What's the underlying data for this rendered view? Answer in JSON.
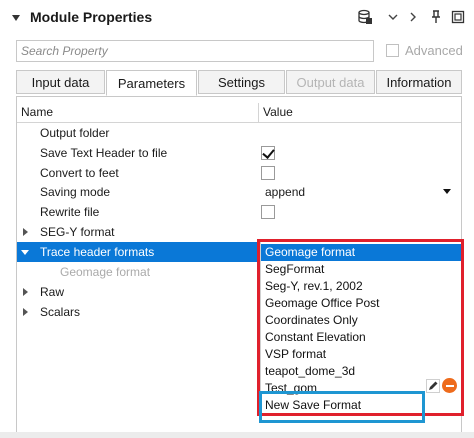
{
  "window": {
    "title": "Module Properties"
  },
  "search": {
    "placeholder": "Search Property"
  },
  "advanced": {
    "label": "Advanced",
    "checked": false
  },
  "tabs": [
    {
      "label": "Input data",
      "state": "normal"
    },
    {
      "label": "Parameters",
      "state": "active"
    },
    {
      "label": "Settings",
      "state": "normal"
    },
    {
      "label": "Output data",
      "state": "disabled"
    },
    {
      "label": "Information",
      "state": "normal"
    }
  ],
  "grid": {
    "headers": {
      "name": "Name",
      "value": "Value"
    },
    "rows": [
      {
        "label": "Output folder"
      },
      {
        "label": "Save Text Header to file",
        "checked": true
      },
      {
        "label": "Convert to feet",
        "checked": false
      },
      {
        "label": "Saving mode",
        "value": "append"
      },
      {
        "label": "Rewrite file",
        "checked": false
      },
      {
        "label": "SEG-Y format",
        "expandable": true
      },
      {
        "label": "Trace header formats",
        "expanded": true,
        "selected": true
      },
      {
        "label": "Geomage format",
        "disabled": true
      },
      {
        "label": "Raw",
        "expandable": true
      },
      {
        "label": "Scalars",
        "expandable": true
      }
    ]
  },
  "dropdown": {
    "selected": "Geomage format",
    "items": [
      "Geomage format",
      "SegFormat",
      "Seg-Y, rev.1, 2002",
      "Geomage Office Post",
      "Coordinates Only",
      "Constant Elevation",
      "VSP format",
      "teapot_dome_3d",
      "Test_gom",
      "New Save Format"
    ]
  },
  "colors": {
    "selection": "#0a78d7",
    "highlight_red": "#e0202c",
    "highlight_blue": "#1e96d2",
    "delete_orange": "#ee6b1c"
  }
}
